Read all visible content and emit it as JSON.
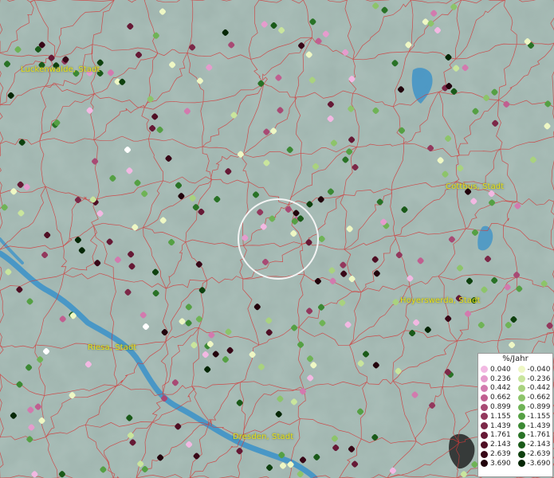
{
  "map": {
    "cities": [
      {
        "name": "Luckenwalde, Stadt"
      },
      {
        "name": "Cottbus, Stadt"
      },
      {
        "name": "Hoyerswerda, Stadt"
      },
      {
        "name": "Riesa, Stadt"
      },
      {
        "name": "Dresden, Stadt"
      }
    ],
    "colors": {
      "terrain": "#9fb4ae",
      "borders": "#d23a3a",
      "rivers": "#3f93c8",
      "label": "#e8e01a"
    }
  },
  "legend": {
    "title": "%/Jahr",
    "positive": [
      "0.040",
      "0.236",
      "0.442",
      "0.662",
      "0.899",
      "1.155",
      "1.439",
      "1.761",
      "2.143",
      "2.639",
      "3.690"
    ],
    "negative": [
      "-0.040",
      "-0.236",
      "-0.442",
      "-0.662",
      "-0.899",
      "-1.155",
      "-1.439",
      "-1.761",
      "-2.143",
      "-2.639",
      "-3.690"
    ],
    "positive_colors": [
      "#f2b8e2",
      "#e59ccd",
      "#d27aae",
      "#c05f90",
      "#a84a74",
      "#93385d",
      "#7c2848",
      "#661935",
      "#4f0f24",
      "#380717",
      "#22030c"
    ],
    "negative_colors": [
      "#eef7c4",
      "#c9e59d",
      "#a9d27f",
      "#8dc46a",
      "#6fb356",
      "#55a044",
      "#3c8934",
      "#297226",
      "#1a5a19",
      "#0f410f",
      "#062706"
    ]
  }
}
